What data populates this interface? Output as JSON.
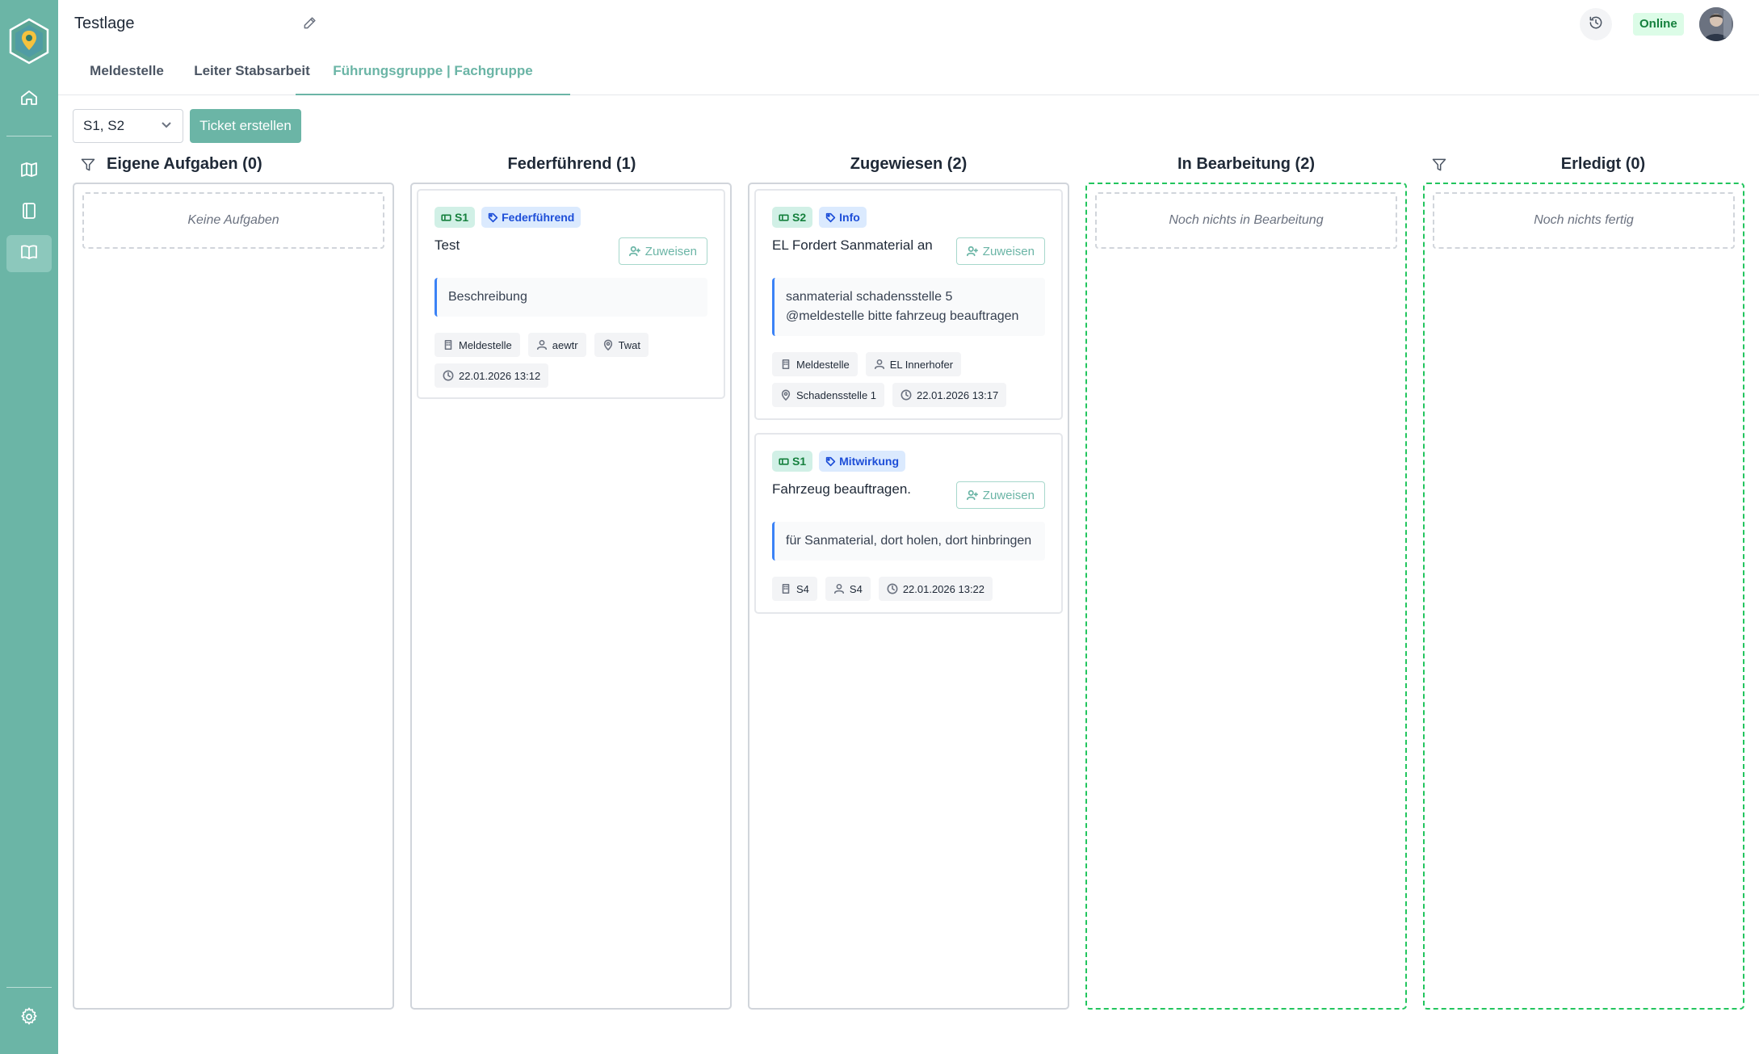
{
  "header": {
    "title": "Testlage",
    "status": "Online"
  },
  "sidebar": {
    "items": [
      {
        "icon": "home-icon"
      },
      {
        "icon": "map-icon"
      },
      {
        "icon": "notebook-icon"
      },
      {
        "icon": "book-icon",
        "active": true
      },
      {
        "icon": "gear-icon"
      }
    ]
  },
  "tabs": [
    {
      "label": "Meldestelle"
    },
    {
      "label": "Leiter Stabsarbeit"
    },
    {
      "label": "Führungsgruppe | Fachgruppe",
      "active": true
    }
  ],
  "toolbar": {
    "select_value": "S1, S2",
    "create_label": "Ticket erstellen"
  },
  "columns": [
    {
      "title": "Eigene Aufgaben (0)",
      "empty_text": "Keine Aufgaben"
    },
    {
      "title": "Federführend (1)"
    },
    {
      "title": "Zugewiesen (2)"
    },
    {
      "title": "In Bearbeitung (2)",
      "empty_text": "Noch nichts in Bearbeitung"
    },
    {
      "title": "Erledigt (0)",
      "empty_text": "Noch nichts fertig"
    }
  ],
  "cards": [
    {
      "group": "S1",
      "type": "Federführend",
      "title": "Test",
      "assign_label": "Zuweisen",
      "description": "Beschreibung",
      "meta": {
        "source": "Meldestelle",
        "person": "aewtr",
        "location": "Twat",
        "time": "22.01.2026 13:12"
      }
    },
    {
      "group": "S2",
      "type": "Info",
      "title": "EL Fordert Sanmaterial an",
      "assign_label": "Zuweisen",
      "description": "sanmaterial schadensstelle 5 @meldestelle bitte fahrzeug beauftragen",
      "meta": {
        "source": "Meldestelle",
        "person": "EL Innerhofer",
        "location": "Schadensstelle 1",
        "time": "22.01.2026 13:17"
      }
    },
    {
      "group": "S1",
      "type": "Mitwirkung",
      "title": "Fahrzeug beauftragen.",
      "assign_label": "Zuweisen",
      "description": "für Sanmaterial, dort holen, dort hinbringen",
      "meta": {
        "source": "S4",
        "person": "S4",
        "time": "22.01.2026 13:22"
      }
    }
  ],
  "colors": {
    "accent": "#6bb5a6",
    "online_bg": "#dcfce7",
    "online_text": "#15803d",
    "group_badge_bg": "#d1f0e6",
    "type_badge_bg": "#dbeafe",
    "done_border": "#22c55e"
  }
}
